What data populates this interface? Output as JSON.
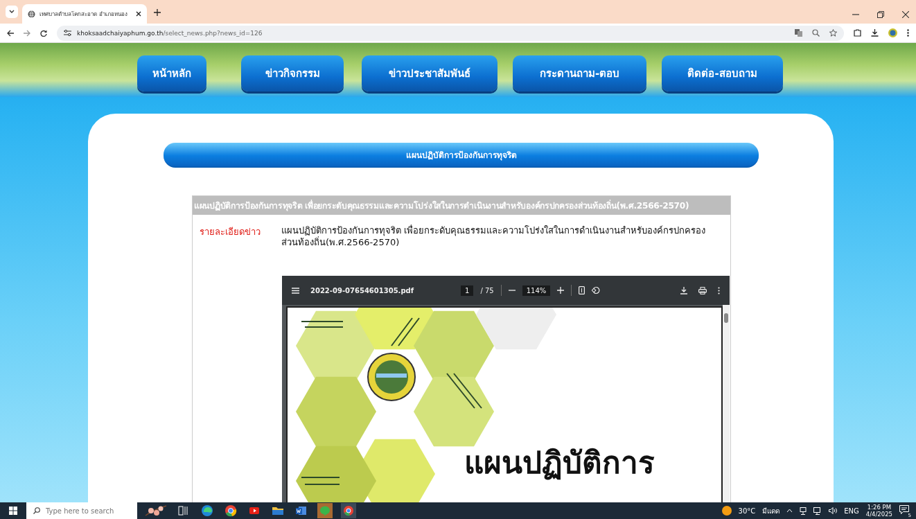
{
  "browser": {
    "tab": {
      "title": "เทศบาลตำบลโคกสะอาด อำเภอหนอง"
    },
    "address": {
      "host": "khoksaadchaiyaphum.go.th",
      "path": "/select_news.php?news_id=126"
    }
  },
  "nav": [
    {
      "label": "หน้าหลัก"
    },
    {
      "label": "ข่าวกิจกรรม"
    },
    {
      "label": "ข่าวประชาสัมพันธ์"
    },
    {
      "label": "กระดานถาม-ตอบ"
    },
    {
      "label": "ติดต่อ-สอบถาม"
    }
  ],
  "section_title": "แผนปฏิบัติการป้องกันการทุจริต",
  "news": {
    "title": "แผนปฏิบัติการป้องกันการทุจริต เพื่อยกระดับคุณธรรมและความโปร่งใสในการดำเนินงานสำหรับองค์กรปกครองส่วนท้องถิ่น(พ.ศ.2566-2570)",
    "detail_label": "รายละเอียดข่าว",
    "detail": "แผนปฏิบัติการป้องกันการทุจริต เพื่อยกระดับคุณธรรมและความโปร่งใสในการดำเนินงานสำหรับองค์กรปกครองส่วนท้องถิ่น(พ.ศ.2566-2570)"
  },
  "pdf_viewer": {
    "filename": "2022-09-07654601305.pdf",
    "page": "1",
    "page_count": "/ 75",
    "zoom": "114%",
    "page_heading": "แผนปฏิบัติการ"
  },
  "taskbar": {
    "search": {
      "placeholder": "Type here to search"
    },
    "weather": {
      "temperature": "30°C",
      "condition": "มีแดด"
    },
    "language": "ENG",
    "time": "1:26 PM",
    "date": "4/4/2025",
    "notifications": "5"
  }
}
